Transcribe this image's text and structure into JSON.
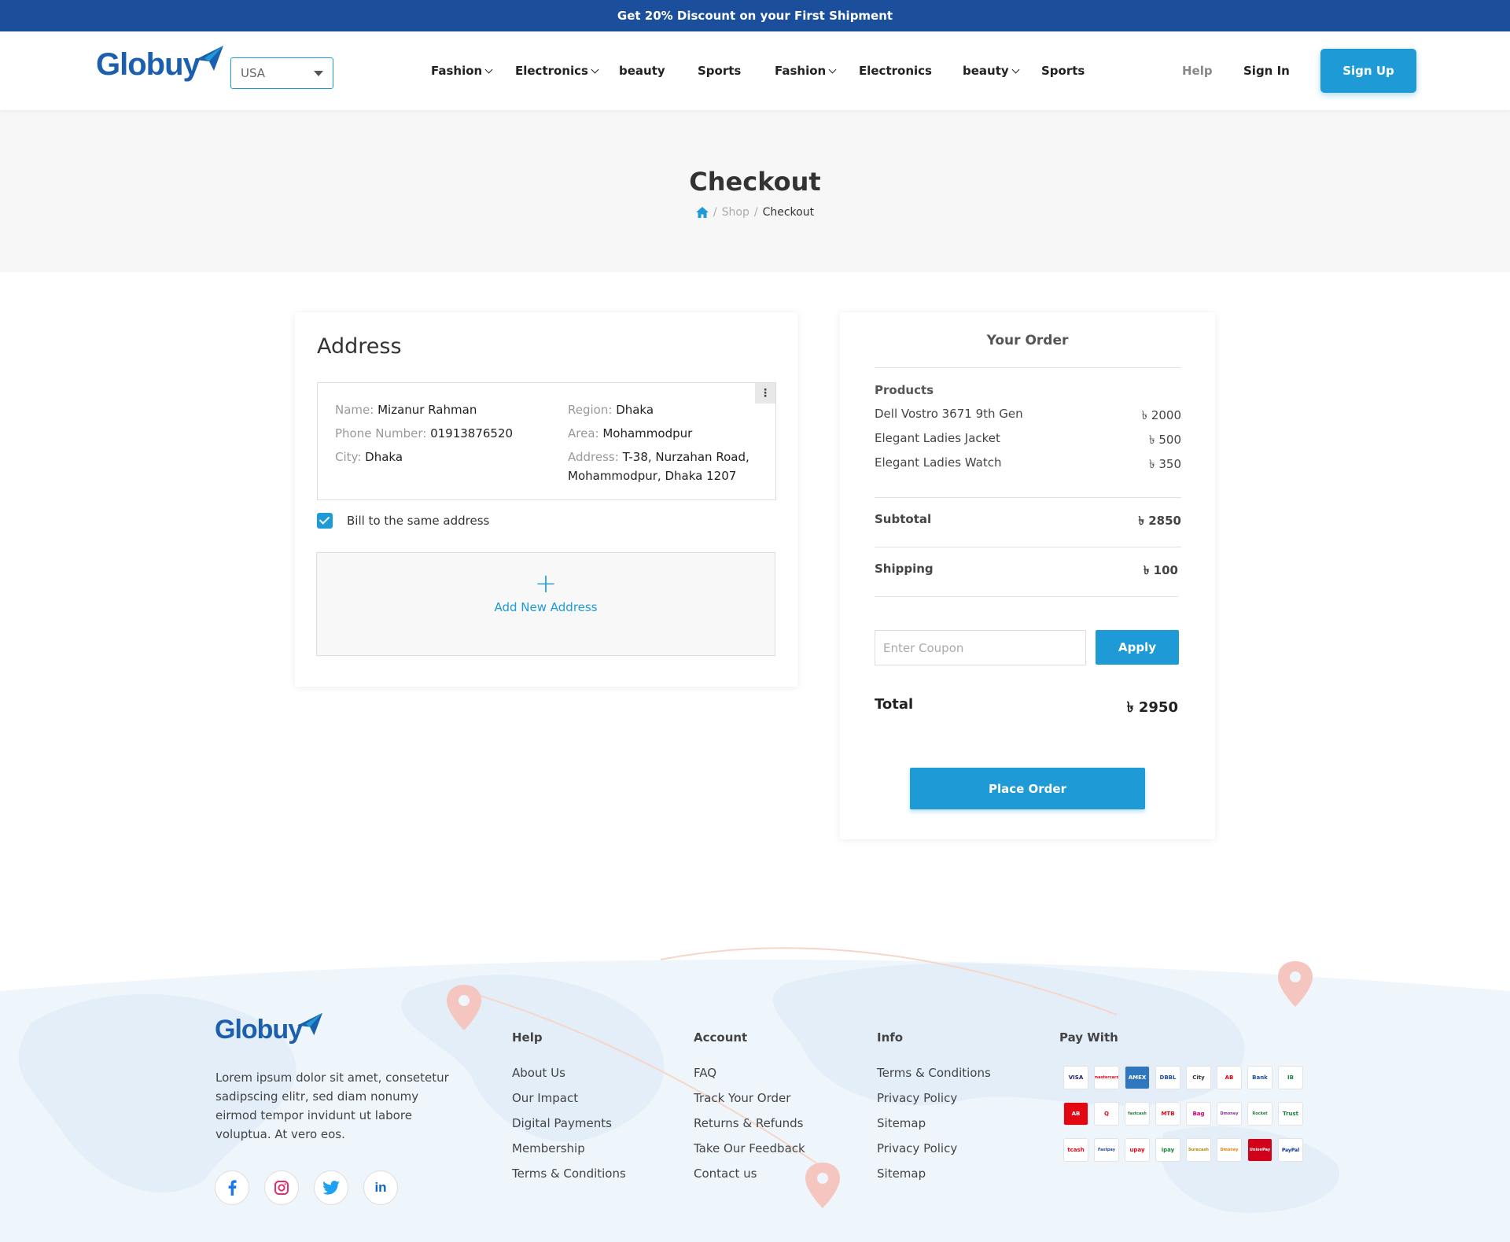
{
  "promo": "Get 20% Discount on your First Shipment",
  "brand": {
    "name": "Globuy",
    "primary": "#1e9bd7",
    "dark": "#1b4f9c"
  },
  "country": {
    "selected": "USA"
  },
  "nav": [
    {
      "label": "Fashion",
      "dropdown": true
    },
    {
      "label": "Electronics",
      "dropdown": true
    },
    {
      "label": "beauty",
      "dropdown": false
    },
    {
      "label": "Sports",
      "dropdown": false
    },
    {
      "label": "Fashion",
      "dropdown": true
    },
    {
      "label": "Electronics",
      "dropdown": false
    },
    {
      "label": "beauty",
      "dropdown": true
    },
    {
      "label": "Sports",
      "dropdown": false
    }
  ],
  "header": {
    "help": "Help",
    "signin": "Sign In",
    "signup": "Sign Up"
  },
  "page": {
    "title": "Checkout",
    "breadcrumb": [
      "Shop",
      "Checkout"
    ]
  },
  "address": {
    "heading": "Address",
    "name_label": "Name:",
    "name": "Mizanur Rahman",
    "phone_label": "Phone Number:",
    "phone": "01913876520",
    "city_label": "City:",
    "city": "Dhaka",
    "region_label": "Region:",
    "region": "Dhaka",
    "area_label": "Area:",
    "area": "Mohammodpur",
    "address_label": "Address:",
    "address_line1": "T-38, Nurzahan Road,",
    "address_line2": "Mohammodpur, Dhaka 1207",
    "bill_same": "Bill to the same address",
    "add_new": "Add New Address"
  },
  "order": {
    "title": "Your Order",
    "products_label": "Products",
    "products": [
      {
        "name": "Dell Vostro 3671 9th Gen",
        "price": "৳ 2000"
      },
      {
        "name": "Elegant Ladies Jacket",
        "price": "৳ 500"
      },
      {
        "name": "Elegant Ladies Watch",
        "price": "৳ 350"
      }
    ],
    "subtotal_label": "Subtotal",
    "subtotal": "৳ 2850",
    "shipping_label": "Shipping",
    "shipping": "৳ 100",
    "coupon_placeholder": "Enter Coupon",
    "apply": "Apply",
    "total_label": "Total",
    "total": "৳ 2950",
    "place_order": "Place Order"
  },
  "footer": {
    "description": "Lorem ipsum dolor sit amet, consetetur sadipscing elitr, sed diam nonumy eirmod tempor invidunt ut labore voluptua. At vero eos.",
    "help": {
      "title": "Help",
      "links": [
        "About Us",
        "Our Impact",
        "Digital Payments",
        "Membership",
        "Terms & Conditions"
      ]
    },
    "account": {
      "title": "Account",
      "links": [
        "FAQ",
        "Track Your Order",
        "Returns & Refunds",
        "Take Our Feedback",
        "Contact us"
      ]
    },
    "info": {
      "title": "Info",
      "links": [
        "Terms & Conditions",
        "Privacy Policy",
        "Sitemap",
        "Privacy Policy",
        "Sitemap"
      ]
    },
    "pay_title": "Pay With",
    "payment_methods": [
      "VISA",
      "mastercard",
      "AMEX",
      "DBBL",
      "City",
      "AB",
      "Bank",
      "IB",
      "AB",
      "Q",
      "fastcash",
      "MTB",
      "Bag",
      "Dmoney",
      "Rocket",
      "Trust",
      "tcash",
      "Fastpay",
      "upay",
      "ipay",
      "Surecash",
      "Dmoney",
      "UnionPay",
      "PayPal"
    ]
  }
}
